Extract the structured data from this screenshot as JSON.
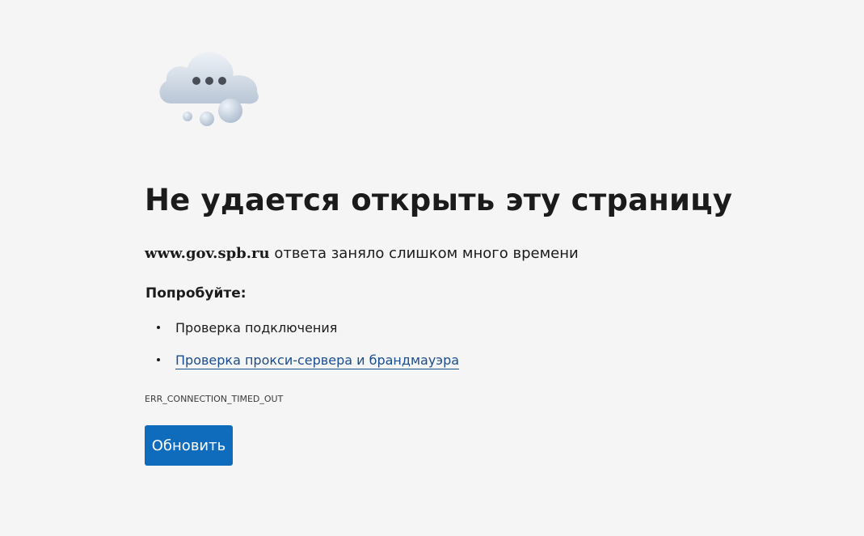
{
  "error": {
    "icon": "cloud-offline-icon",
    "title": "Не удается открыть эту страницу",
    "host": "www.gov.spb.ru",
    "message_suffix": " ответа заняло слишком много времени",
    "try_heading": "Попробуйте:",
    "suggestions": [
      {
        "label": "Проверка подключения",
        "is_link": false
      },
      {
        "label": "Проверка прокси-сервера и брандмауэра",
        "is_link": true
      }
    ],
    "code": "ERR_CONNECTION_TIMED_OUT",
    "reload_label": "Обновить"
  },
  "colors": {
    "background": "#f5f5f5",
    "text": "#1b1b1b",
    "link": "#1a4d8c",
    "button": "#0f6cbd",
    "button_text": "#ffffff"
  }
}
